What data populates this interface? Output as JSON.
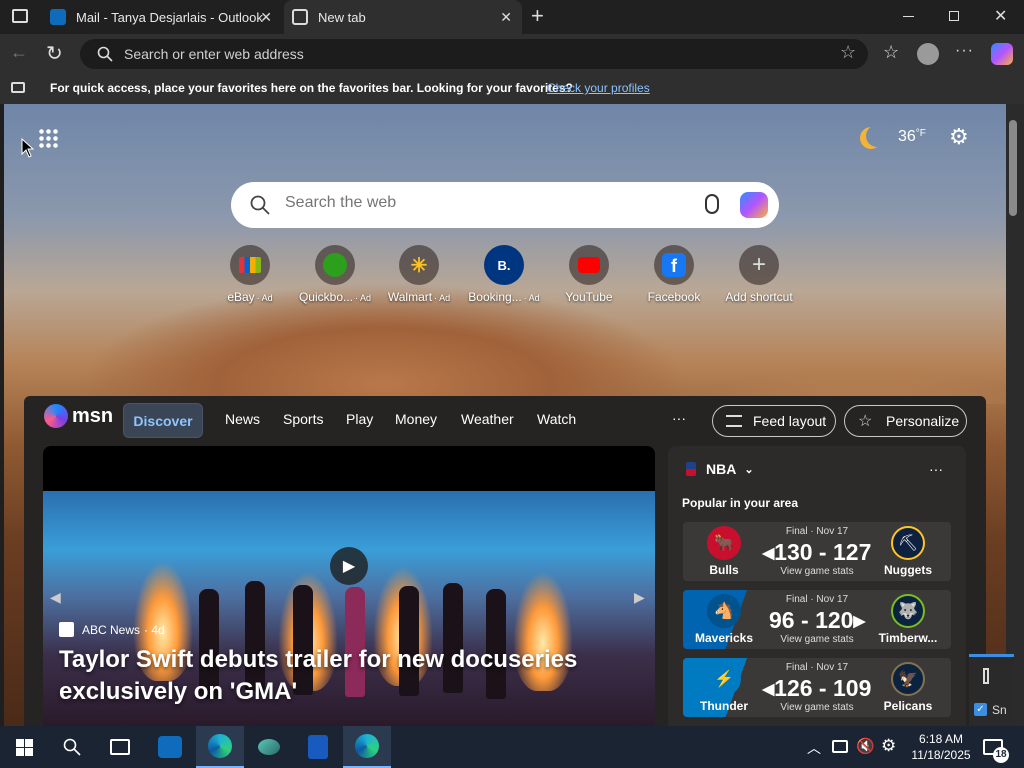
{
  "browser": {
    "tabs": [
      {
        "label": "Mail - Tanya Desjarlais - Outlook"
      },
      {
        "label": "New tab"
      }
    ],
    "address_placeholder": "Search or enter web address",
    "favorites_bar": {
      "message": "For quick access, place your favorites here on the favorites bar. Looking for your favorites?",
      "link": "Check your profiles"
    }
  },
  "newtab": {
    "weather": {
      "temp": "36",
      "unit": "°F"
    },
    "search_placeholder": "Search the web",
    "shortcuts": [
      {
        "label": "eBay",
        "ad": "· Ad",
        "icon": "ebay-icon"
      },
      {
        "label": "Quickbo...",
        "ad": "· Ad",
        "icon": "quickbooks-icon"
      },
      {
        "label": "Walmart",
        "ad": "· Ad",
        "icon": "walmart-icon"
      },
      {
        "label": "Booking...",
        "ad": "· Ad",
        "icon": "booking-icon",
        "glyph": "B."
      },
      {
        "label": "YouTube",
        "ad": "",
        "icon": "youtube-icon"
      },
      {
        "label": "Facebook",
        "ad": "",
        "icon": "facebook-icon",
        "glyph": "f"
      },
      {
        "label": "Add shortcut",
        "ad": "",
        "icon": "plus-icon",
        "glyph": "+"
      }
    ]
  },
  "feed": {
    "brand": "msn",
    "nav": [
      "Discover",
      "News",
      "Sports",
      "Play",
      "Money",
      "Weather",
      "Watch"
    ],
    "more": "···",
    "feed_layout": "Feed layout",
    "personalize": "Personalize",
    "hero": {
      "source": "ABC News",
      "age": "· 4d",
      "headline": "Taylor Swift debuts trailer for new docuseries exclusively on 'GMA'"
    },
    "nba": {
      "title": "NBA",
      "subtitle": "Popular in your area",
      "games": [
        {
          "status": "Final · Nov 17",
          "home": "Bulls",
          "away": "Nuggets",
          "home_score": "130",
          "away_score": "127",
          "link": "View game stats",
          "stripe": "#c8102e"
        },
        {
          "status": "Final · Nov 17",
          "home": "Mavericks",
          "away": "Timberw...",
          "home_score": "96",
          "away_score": "120",
          "link": "View game stats",
          "stripe": "#0064b1"
        },
        {
          "status": "Final · Nov 17",
          "home": "Thunder",
          "away": "Pelicans",
          "home_score": "126",
          "away_score": "109",
          "link": "View game stats",
          "stripe": "#007ac1"
        }
      ]
    }
  },
  "widget_label": "Sn",
  "taskbar": {
    "time": "6:18 AM",
    "date": "11/18/2025",
    "notifications": "18"
  }
}
